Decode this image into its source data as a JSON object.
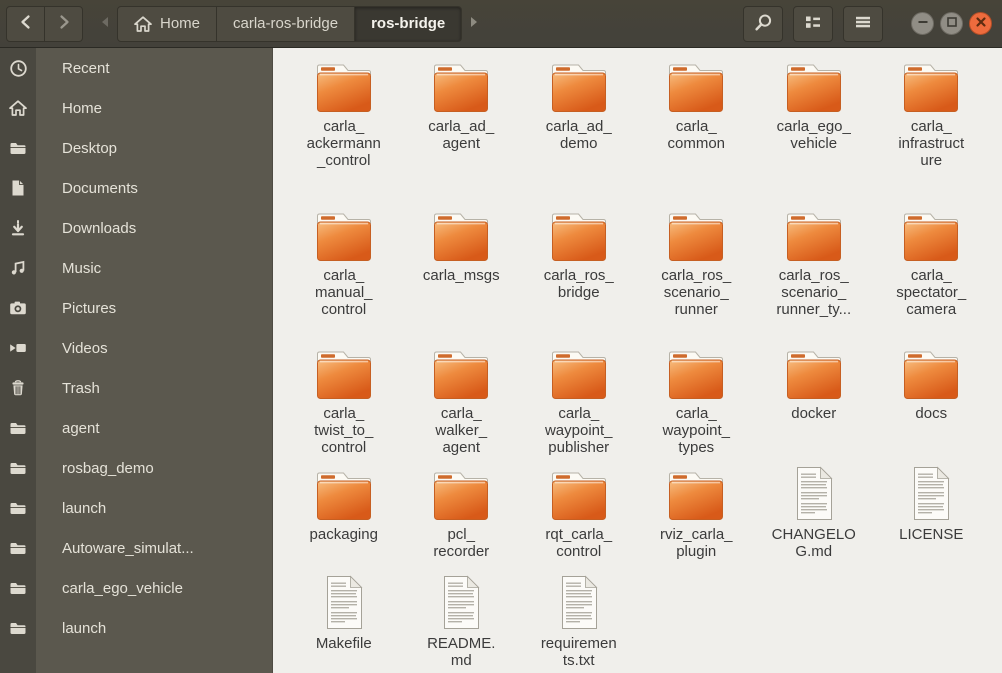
{
  "header": {
    "nav": [
      {
        "name": "back-button",
        "icon": "chevron-left-icon"
      },
      {
        "name": "forward-button",
        "icon": "chevron-right-icon"
      }
    ],
    "path_scroll_left_icon": "triangle-left-icon",
    "path_scroll_right_icon": "triangle-right-icon",
    "breadcrumbs": [
      {
        "label": "Home",
        "icon": "home-icon",
        "active": false
      },
      {
        "label": "carla-ros-bridge",
        "active": false
      },
      {
        "label": "ros-bridge",
        "active": true
      }
    ],
    "actions": [
      {
        "name": "search-button",
        "icon": "search-icon"
      },
      {
        "name": "view-toggle-button",
        "icon": "list-view-icon"
      },
      {
        "name": "menu-button",
        "icon": "hamburger-icon"
      }
    ],
    "window_controls": [
      {
        "name": "minimize-button",
        "icon": "minimize-icon"
      },
      {
        "name": "maximize-button",
        "icon": "maximize-icon"
      },
      {
        "name": "close-button",
        "icon": "close-icon"
      }
    ]
  },
  "sidebar": {
    "places": [
      {
        "label": "Recent",
        "icon": "clock-icon"
      },
      {
        "label": "Home",
        "icon": "home-icon"
      },
      {
        "label": "Desktop",
        "icon": "folder-icon"
      },
      {
        "label": "Documents",
        "icon": "document-icon"
      },
      {
        "label": "Downloads",
        "icon": "download-icon"
      },
      {
        "label": "Music",
        "icon": "music-icon"
      },
      {
        "label": "Pictures",
        "icon": "camera-icon"
      },
      {
        "label": "Videos",
        "icon": "video-icon"
      },
      {
        "label": "Trash",
        "icon": "trash-icon"
      }
    ],
    "bookmarks": [
      {
        "label": "agent",
        "icon": "folder-icon"
      },
      {
        "label": "rosbag_demo",
        "icon": "folder-icon"
      },
      {
        "label": "launch",
        "icon": "folder-icon"
      },
      {
        "label": "Autoware_simulat...",
        "icon": "folder-icon"
      },
      {
        "label": "carla_ego_vehicle",
        "icon": "folder-icon"
      },
      {
        "label": "launch",
        "icon": "folder-icon"
      }
    ]
  },
  "files": {
    "rows": [
      [
        {
          "name": "carla_\nackermann\n_control",
          "type": "folder"
        },
        {
          "name": "carla_ad_\nagent",
          "type": "folder"
        },
        {
          "name": "carla_ad_\ndemo",
          "type": "folder"
        },
        {
          "name": "carla_\ncommon",
          "type": "folder"
        },
        {
          "name": "carla_ego_\nvehicle",
          "type": "folder"
        },
        {
          "name": "carla_\ninfrastruct\nure",
          "type": "folder"
        }
      ],
      [
        {
          "name": "carla_\nmanual_\ncontrol",
          "type": "folder"
        },
        {
          "name": "carla_msgs",
          "type": "folder"
        },
        {
          "name": "carla_ros_\nbridge",
          "type": "folder"
        },
        {
          "name": "carla_ros_\nscenario_\nrunner",
          "type": "folder"
        },
        {
          "name": "carla_ros_\nscenario_\nrunner_ty...",
          "type": "folder"
        },
        {
          "name": "carla_\nspectator_\ncamera",
          "type": "folder"
        }
      ],
      [
        {
          "name": "carla_\ntwist_to_\ncontrol",
          "type": "folder"
        },
        {
          "name": "carla_\nwalker_\nagent",
          "type": "folder"
        },
        {
          "name": "carla_\nwaypoint_\npublisher",
          "type": "folder"
        },
        {
          "name": "carla_\nwaypoint_\ntypes",
          "type": "folder"
        },
        {
          "name": "docker",
          "type": "folder"
        },
        {
          "name": "docs",
          "type": "folder"
        }
      ],
      [
        {
          "name": "packaging",
          "type": "folder"
        },
        {
          "name": "pcl_\nrecorder",
          "type": "folder"
        },
        {
          "name": "rqt_carla_\ncontrol",
          "type": "folder"
        },
        {
          "name": "rviz_carla_\nplugin",
          "type": "folder"
        },
        {
          "name": "CHANGELO\nG.md",
          "type": "text-file"
        },
        {
          "name": "LICENSE",
          "type": "text-file"
        }
      ],
      [
        {
          "name": "Makefile",
          "type": "text-file"
        },
        {
          "name": "README.\nmd",
          "type": "text-file"
        },
        {
          "name": "requiremen\nts.txt",
          "type": "text-file"
        }
      ]
    ]
  },
  "colors": {
    "folder_orange": "#e8823a",
    "close_button_orange": "#ed6b3d",
    "header_bg": "#45433a",
    "sidebar_bg": "#5b584e",
    "sidebar_strip_bg": "#4a4840",
    "content_bg": "#f0efeb"
  }
}
